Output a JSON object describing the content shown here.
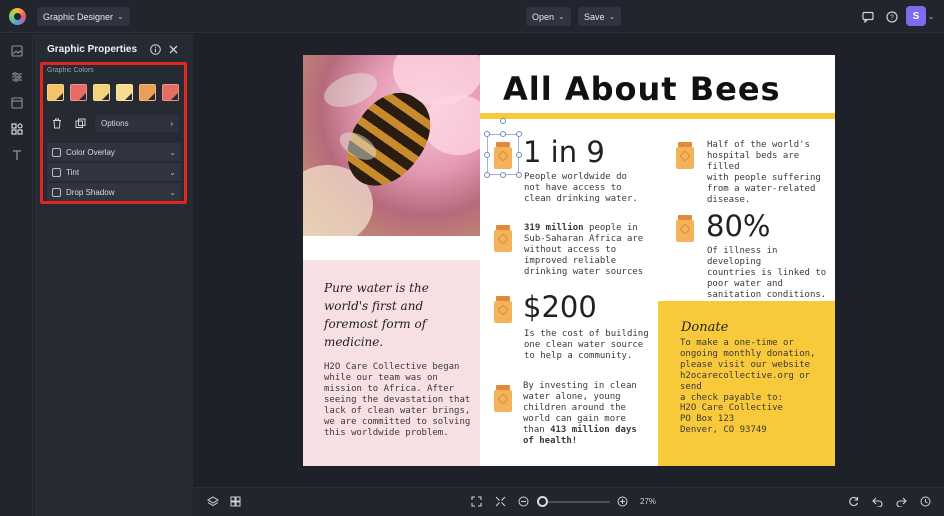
{
  "topbar": {
    "project_name": "Graphic Designer",
    "open_label": "Open",
    "save_label": "Save",
    "avatar_initial": "S"
  },
  "panel": {
    "title": "Graphic Properties",
    "colors_label": "Graphic Colors",
    "swatches": [
      "#f2c36b",
      "#e96b67",
      "#f5d37a",
      "#f7dc8f",
      "#e9a056",
      "#e56d64"
    ],
    "options_label": "Options",
    "effects": [
      "Color Overlay",
      "Tint",
      "Drop Shadow"
    ]
  },
  "canvas": {
    "title": "All About Bees",
    "quote": "Pure water is the world's first and foremost form of medicine.",
    "quote_body": "H2O Care Collective began\nwhile our team was on\nmission to Africa. After\nseeing the devastation that\nlack of clean water brings,\nwe are committed to solving\nthis worldwide problem.",
    "stat1_value": "1 in 9",
    "stat1_text": "People worldwide do\nnot have access to\nclean drinking water.",
    "stat2_bold": "319 million",
    "stat2_text_a": " people in",
    "stat2_text_b": "Sub-Saharan Africa are\nwithout access to\nimproved reliable\ndrinking water sources",
    "stat3_value": "$200",
    "stat3_text": "Is the cost of building\none clean water source\nto help a community.",
    "stat4_text": "By investing in clean\nwater alone, young\nchildren around the\nworld can gain more",
    "stat4_than": "than ",
    "stat4_bold_a": "413 million days",
    "stat4_bold_b": "of health!",
    "stat5_text": "Half of the world's\nhospital beds are filled\nwith people suffering\nfrom a water-related\ndisease.",
    "stat6_value": "80%",
    "stat6_text": "Of illness in developing\ncountries is linked to\npoor water and\nsanitation conditions.",
    "donate_title": "Donate",
    "donate_text": "To make a one-time or\nongoing monthly donation,\nplease visit our website\nh2ocarecollective.org or send\na check payable to:",
    "address": "H2O Care Collective\nPO Box 123\nDenver, CO 93749"
  },
  "bottombar": {
    "zoom": "27%"
  },
  "colors": {
    "accent_yellow": "#f8c93a",
    "accent_pink": "#f6e0e3",
    "highlight_red": "#e0261f"
  }
}
